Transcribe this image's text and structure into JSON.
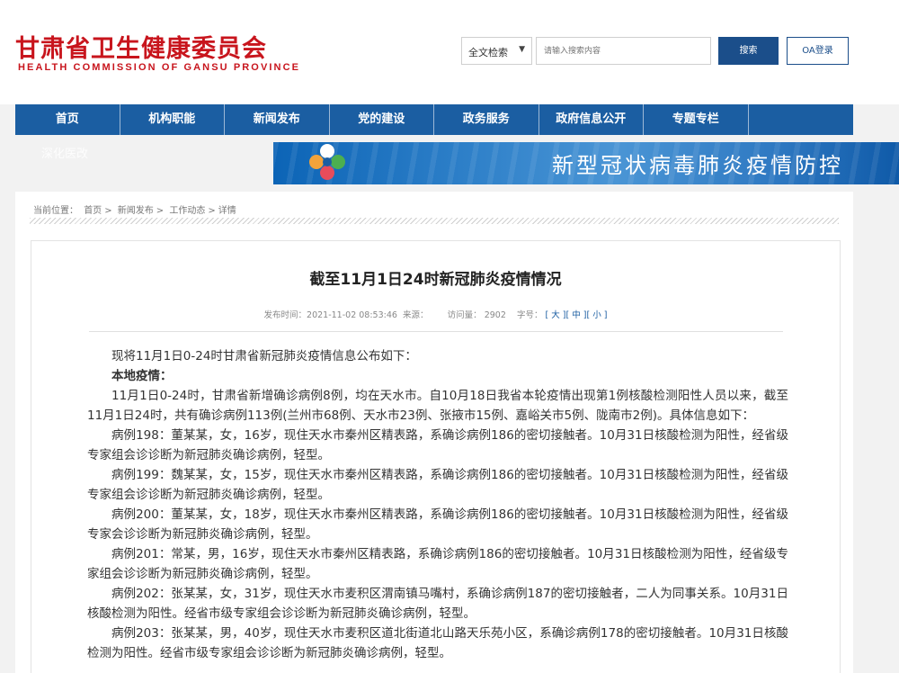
{
  "header": {
    "logo_cn": "甘肃省卫生健康委员会",
    "logo_en": "HEALTH COMMISSION OF GANSU PROVINCE"
  },
  "search": {
    "scope": "全文检索",
    "placeholder": "请输入搜索内容",
    "button": "搜索",
    "oa_button": "OA登录"
  },
  "nav": {
    "items": [
      "首页",
      "机构职能",
      "新闻发布",
      "党的建设",
      "政务服务",
      "政府信息公开",
      "专题专栏",
      ""
    ],
    "overflow_item": "深化医改"
  },
  "banner": {
    "title": "新型冠状病毒肺炎疫情防控"
  },
  "breadcrumb": {
    "label": "当前位置：",
    "items": [
      "首页",
      "新闻发布",
      "工作动态",
      "详情"
    ],
    "sep": ">"
  },
  "article": {
    "title": "截至11月1日24时新冠肺炎疫情情况",
    "meta": {
      "publish_label": "发布时间：",
      "publish_time": "2021-11-02 08:53:46",
      "source_label": "来源：",
      "views_label": "访问量：",
      "views": "2902",
      "fontsize_label": "字号：",
      "large": "大",
      "medium": "中",
      "small": "小"
    },
    "paragraphs": [
      "现将11月1日0-24时甘肃省新冠肺炎疫情信息公布如下：",
      "本地疫情：",
      "11月1日0-24时，甘肃省新增确诊病例8例，均在天水市。自10月18日我省本轮疫情出现第1例核酸检测阳性人员以来，截至11月1日24时，共有确诊病例113例(兰州市68例、天水市23例、张掖市15例、嘉峪关市5例、陇南市2例)。具体信息如下：",
      "病例198：董某某，女，16岁，现住天水市秦州区精表路，系确诊病例186的密切接触者。10月31日核酸检测为阳性，经省级专家组会诊诊断为新冠肺炎确诊病例，轻型。",
      "病例199：魏某某，女，15岁，现住天水市秦州区精表路，系确诊病例186的密切接触者。10月31日核酸检测为阳性，经省级专家组会诊诊断为新冠肺炎确诊病例，轻型。",
      "病例200：董某某，女，18岁，现住天水市秦州区精表路，系确诊病例186的密切接触者。10月31日核酸检测为阳性，经省级专家会诊诊断为新冠肺炎确诊病例，轻型。",
      "病例201：常某，男，16岁，现住天水市秦州区精表路，系确诊病例186的密切接触者。10月31日核酸检测为阳性，经省级专家组会诊诊断为新冠肺炎确诊病例，轻型。",
      "病例202：张某某，女，31岁，现住天水市麦积区渭南镇马嘴村，系确诊病例187的密切接触者，二人为同事关系。10月31日核酸检测为阳性。经省市级专家组会诊诊断为新冠肺炎确诊病例，轻型。",
      "病例203：张某某，男，40岁，现住天水市麦积区道北街道北山路天乐苑小区，系确诊病例178的密切接触者。10月31日核酸检测为阳性。经省市级专家组会诊诊断为新冠肺炎确诊病例，轻型。"
    ]
  }
}
